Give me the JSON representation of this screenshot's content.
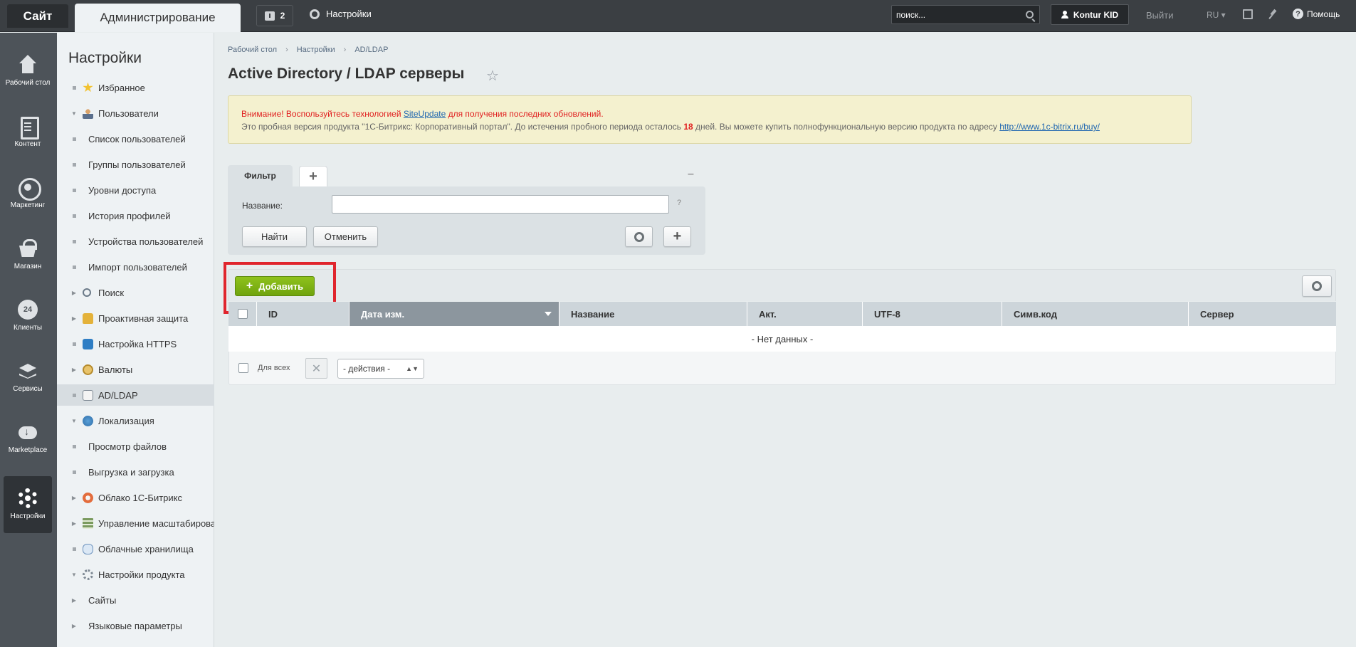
{
  "topbar": {
    "site_label": "Сайт",
    "admin_label": "Администрирование",
    "notify_count": "2",
    "settings_label": "Настройки",
    "search_placeholder": "поиск...",
    "user_name": "Kontur KID",
    "logout_label": "Выйти",
    "lang_label": "RU",
    "help_label": "Помощь"
  },
  "leftmenu": {
    "items": [
      {
        "label": "Рабочий стол",
        "icon": "home-icon"
      },
      {
        "label": "Контент",
        "icon": "document-icon"
      },
      {
        "label": "Маркетинг",
        "icon": "target-icon"
      },
      {
        "label": "Магазин",
        "icon": "basket-icon"
      },
      {
        "label": "Клиенты",
        "icon": "clients-24-icon",
        "badge": "24"
      },
      {
        "label": "Сервисы",
        "icon": "layers-icon"
      },
      {
        "label": "Marketplace",
        "icon": "cloud-download-icon"
      },
      {
        "label": "Настройки",
        "icon": "gear-icon",
        "active": true
      }
    ]
  },
  "tree": {
    "title": "Настройки",
    "items": [
      {
        "label": "Избранное",
        "level": 0,
        "expander": "dot"
      },
      {
        "label": "Пользователи",
        "level": 0,
        "expander": "open"
      },
      {
        "label": "Список пользователей",
        "level": 1
      },
      {
        "label": "Группы пользователей",
        "level": 1
      },
      {
        "label": "Уровни доступа",
        "level": 1
      },
      {
        "label": "История профилей",
        "level": 1
      },
      {
        "label": "Устройства пользователей",
        "level": 1
      },
      {
        "label": "Импорт пользователей",
        "level": 1
      },
      {
        "label": "Поиск",
        "level": 0,
        "expander": "closed"
      },
      {
        "label": "Проактивная защита",
        "level": 0,
        "expander": "closed"
      },
      {
        "label": "Настройка HTTPS",
        "level": 0,
        "expander": "dot"
      },
      {
        "label": "Валюты",
        "level": 0,
        "expander": "closed"
      },
      {
        "label": "AD/LDAP",
        "level": 0,
        "expander": "dot",
        "selected": true
      },
      {
        "label": "Локализация",
        "level": 0,
        "expander": "open"
      },
      {
        "label": "Просмотр файлов",
        "level": 1
      },
      {
        "label": "Выгрузка и загрузка",
        "level": 1
      },
      {
        "label": "Облако 1С-Битрикс",
        "level": 0,
        "expander": "closed"
      },
      {
        "label": "Управление масштабирова",
        "level": 0,
        "expander": "closed"
      },
      {
        "label": "Облачные хранилища",
        "level": 0,
        "expander": "dot"
      },
      {
        "label": "Настройки продукта",
        "level": 0,
        "expander": "open"
      },
      {
        "label": "Сайты",
        "level": 1,
        "expander": "closed"
      },
      {
        "label": "Языковые параметры",
        "level": 1,
        "expander": "closed"
      }
    ]
  },
  "breadcrumb": [
    "Рабочий стол",
    "Настройки",
    "AD/LDAP"
  ],
  "page_title": "Active Directory / LDAP серверы",
  "notice": {
    "line1_prefix": "Внимание! Воспользуйтесь технологией ",
    "line1_link": "SiteUpdate",
    "line1_suffix": " для получения последних обновлений.",
    "line2_prefix": "Это пробная версия продукта \"1С-Битрикс: Корпоративный портал\". До истечения пробного периода осталось ",
    "line2_days": "18",
    "line2_middle": " дней. Вы можете купить полнофункциональную версию продукта по адресу ",
    "line2_link": "http://www.1c-bitrix.ru/buy/"
  },
  "filter": {
    "tab_label": "Фильтр",
    "name_label": "Название:",
    "name_value": "",
    "help_mark": "?",
    "find_label": "Найти",
    "cancel_label": "Отменить"
  },
  "list": {
    "add_label": "Добавить",
    "columns": [
      "ID",
      "Дата изм.",
      "Название",
      "Акт.",
      "UTF-8",
      "Симв.код",
      "Сервер"
    ],
    "sorted_column": "Дата изм.",
    "empty_text": "- Нет данных -",
    "for_all_label": "Для всех",
    "actions_select": "- действия -"
  },
  "colors": {
    "topbar": "#3b3f43",
    "leftbar": "#4d5359",
    "accent_green": "#7fb315",
    "highlight_red": "#e0252d",
    "notice_bg": "#f4f1cf"
  }
}
